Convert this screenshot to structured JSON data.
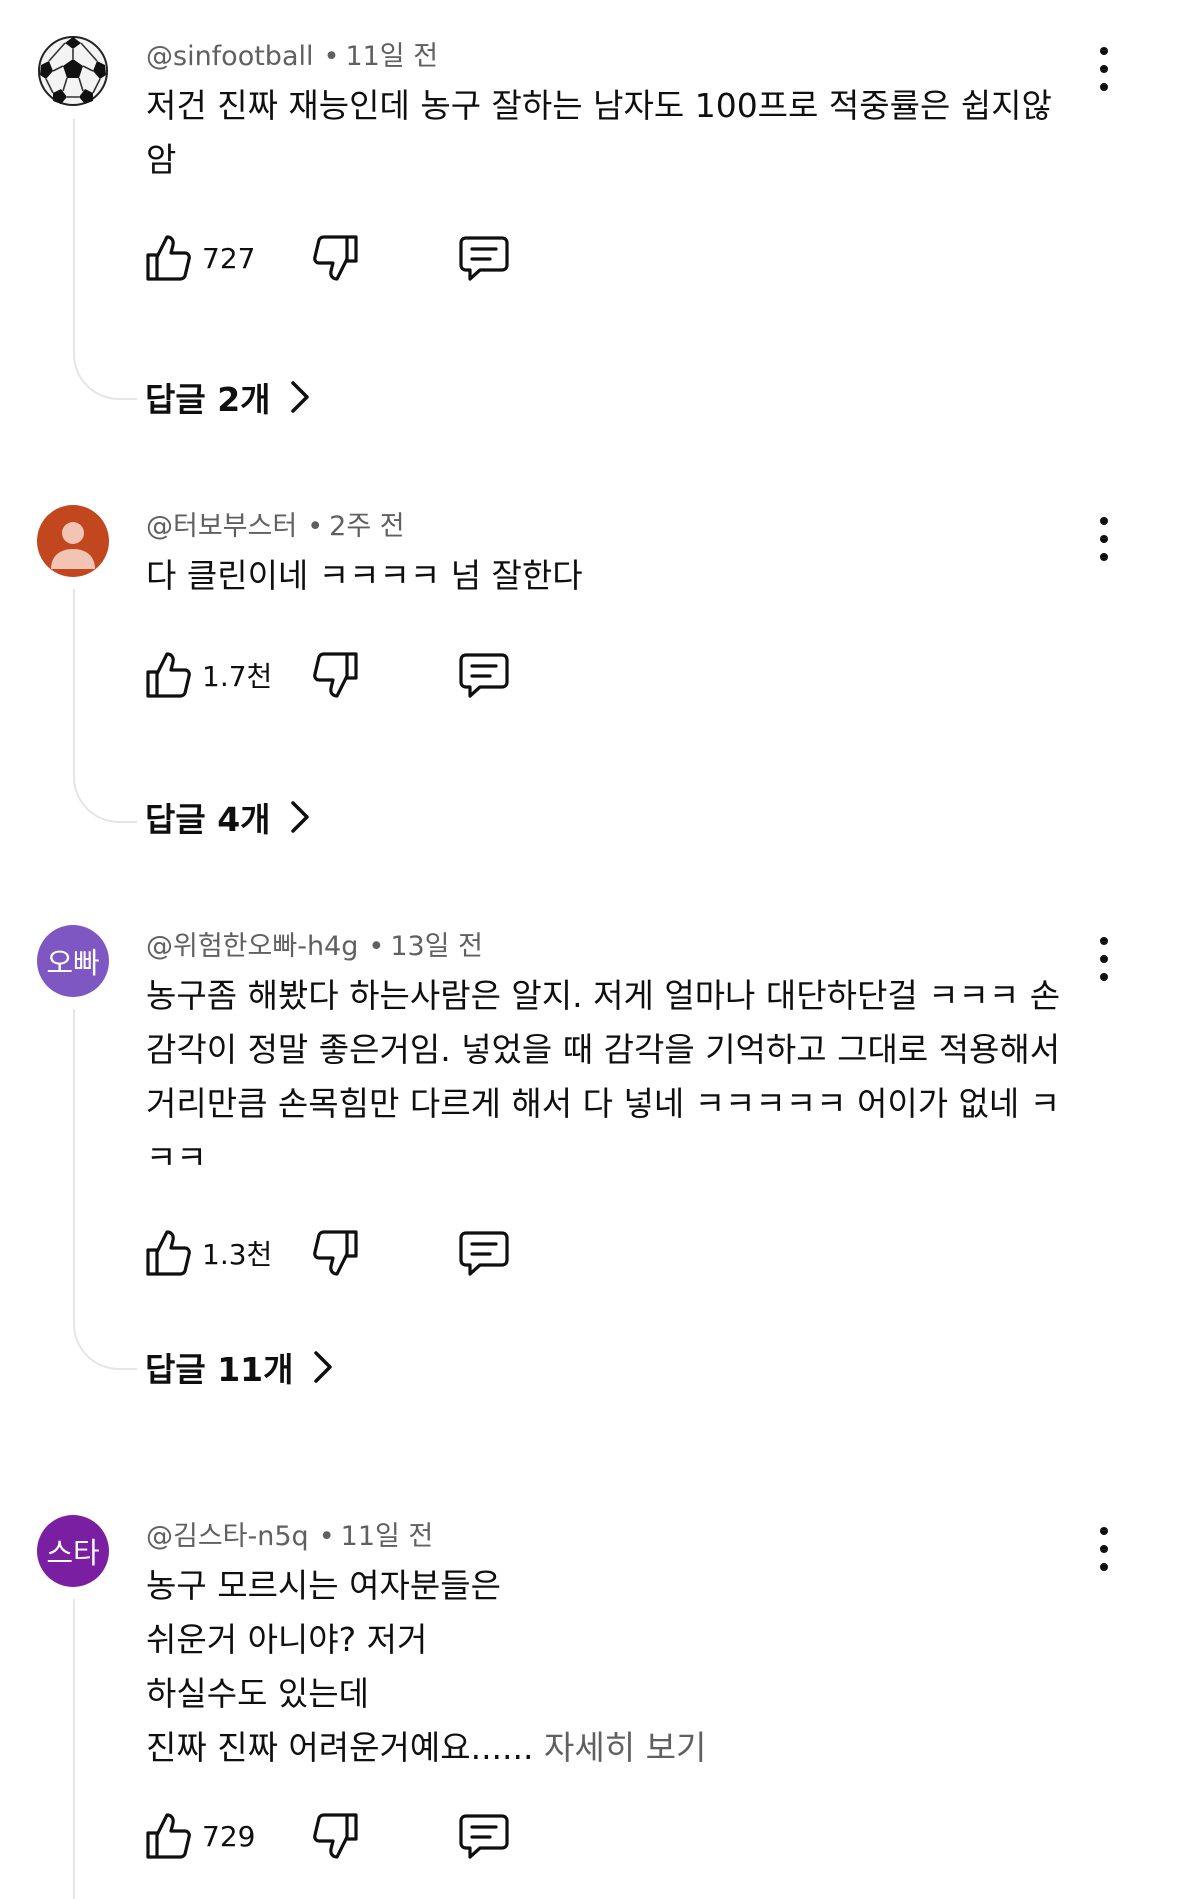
{
  "comments": [
    {
      "handle": "@sinfootball",
      "time": "11일 전",
      "lines": [
        "저건 진짜 재능인데 농구 잘하는 남자도 100프로 적중률은 쉽지않",
        "암"
      ],
      "likes": "727",
      "replies_label": "답글 2개",
      "avatar": {
        "icon": "soccer-ball-icon"
      }
    },
    {
      "handle": "@터보부스터",
      "time": "2주 전",
      "lines": [
        "다 클린이네 ㅋㅋㅋㅋ 넘 잘한다"
      ],
      "likes": "1.7천",
      "replies_label": "답글 4개",
      "avatar": {
        "icon": "default-person-icon",
        "color": "#c2461e"
      }
    },
    {
      "handle": "@위험한오빠-h4g",
      "time": "13일 전",
      "lines": [
        "농구좀 해봤다 하는사람은 알지. 저게 얼마나 대단하단걸 ㅋㅋㅋ 손",
        "감각이 정말 좋은거임. 넣었을 때 감각을 기억하고 그대로 적용해서",
        "거리만큼 손목힘만 다르게 해서 다 넣네 ㅋㅋㅋㅋㅋ 어이가 없네 ㅋ",
        "ㅋㅋ"
      ],
      "likes": "1.3천",
      "replies_label": "답글 11개",
      "avatar": {
        "text": "오빠",
        "color": "#7e57c2"
      }
    },
    {
      "handle": "@김스타-n5q",
      "time": "11일 전",
      "lines": [
        "농구 모르시는 여자분들은",
        "쉬운거 아니야? 저거",
        "하실수도 있는데",
        "진짜 진짜 어려운거예요......"
      ],
      "more_label": "자세히 보기",
      "likes": "729",
      "avatar": {
        "text": "스타",
        "color": "#7b1fa2"
      }
    }
  ]
}
